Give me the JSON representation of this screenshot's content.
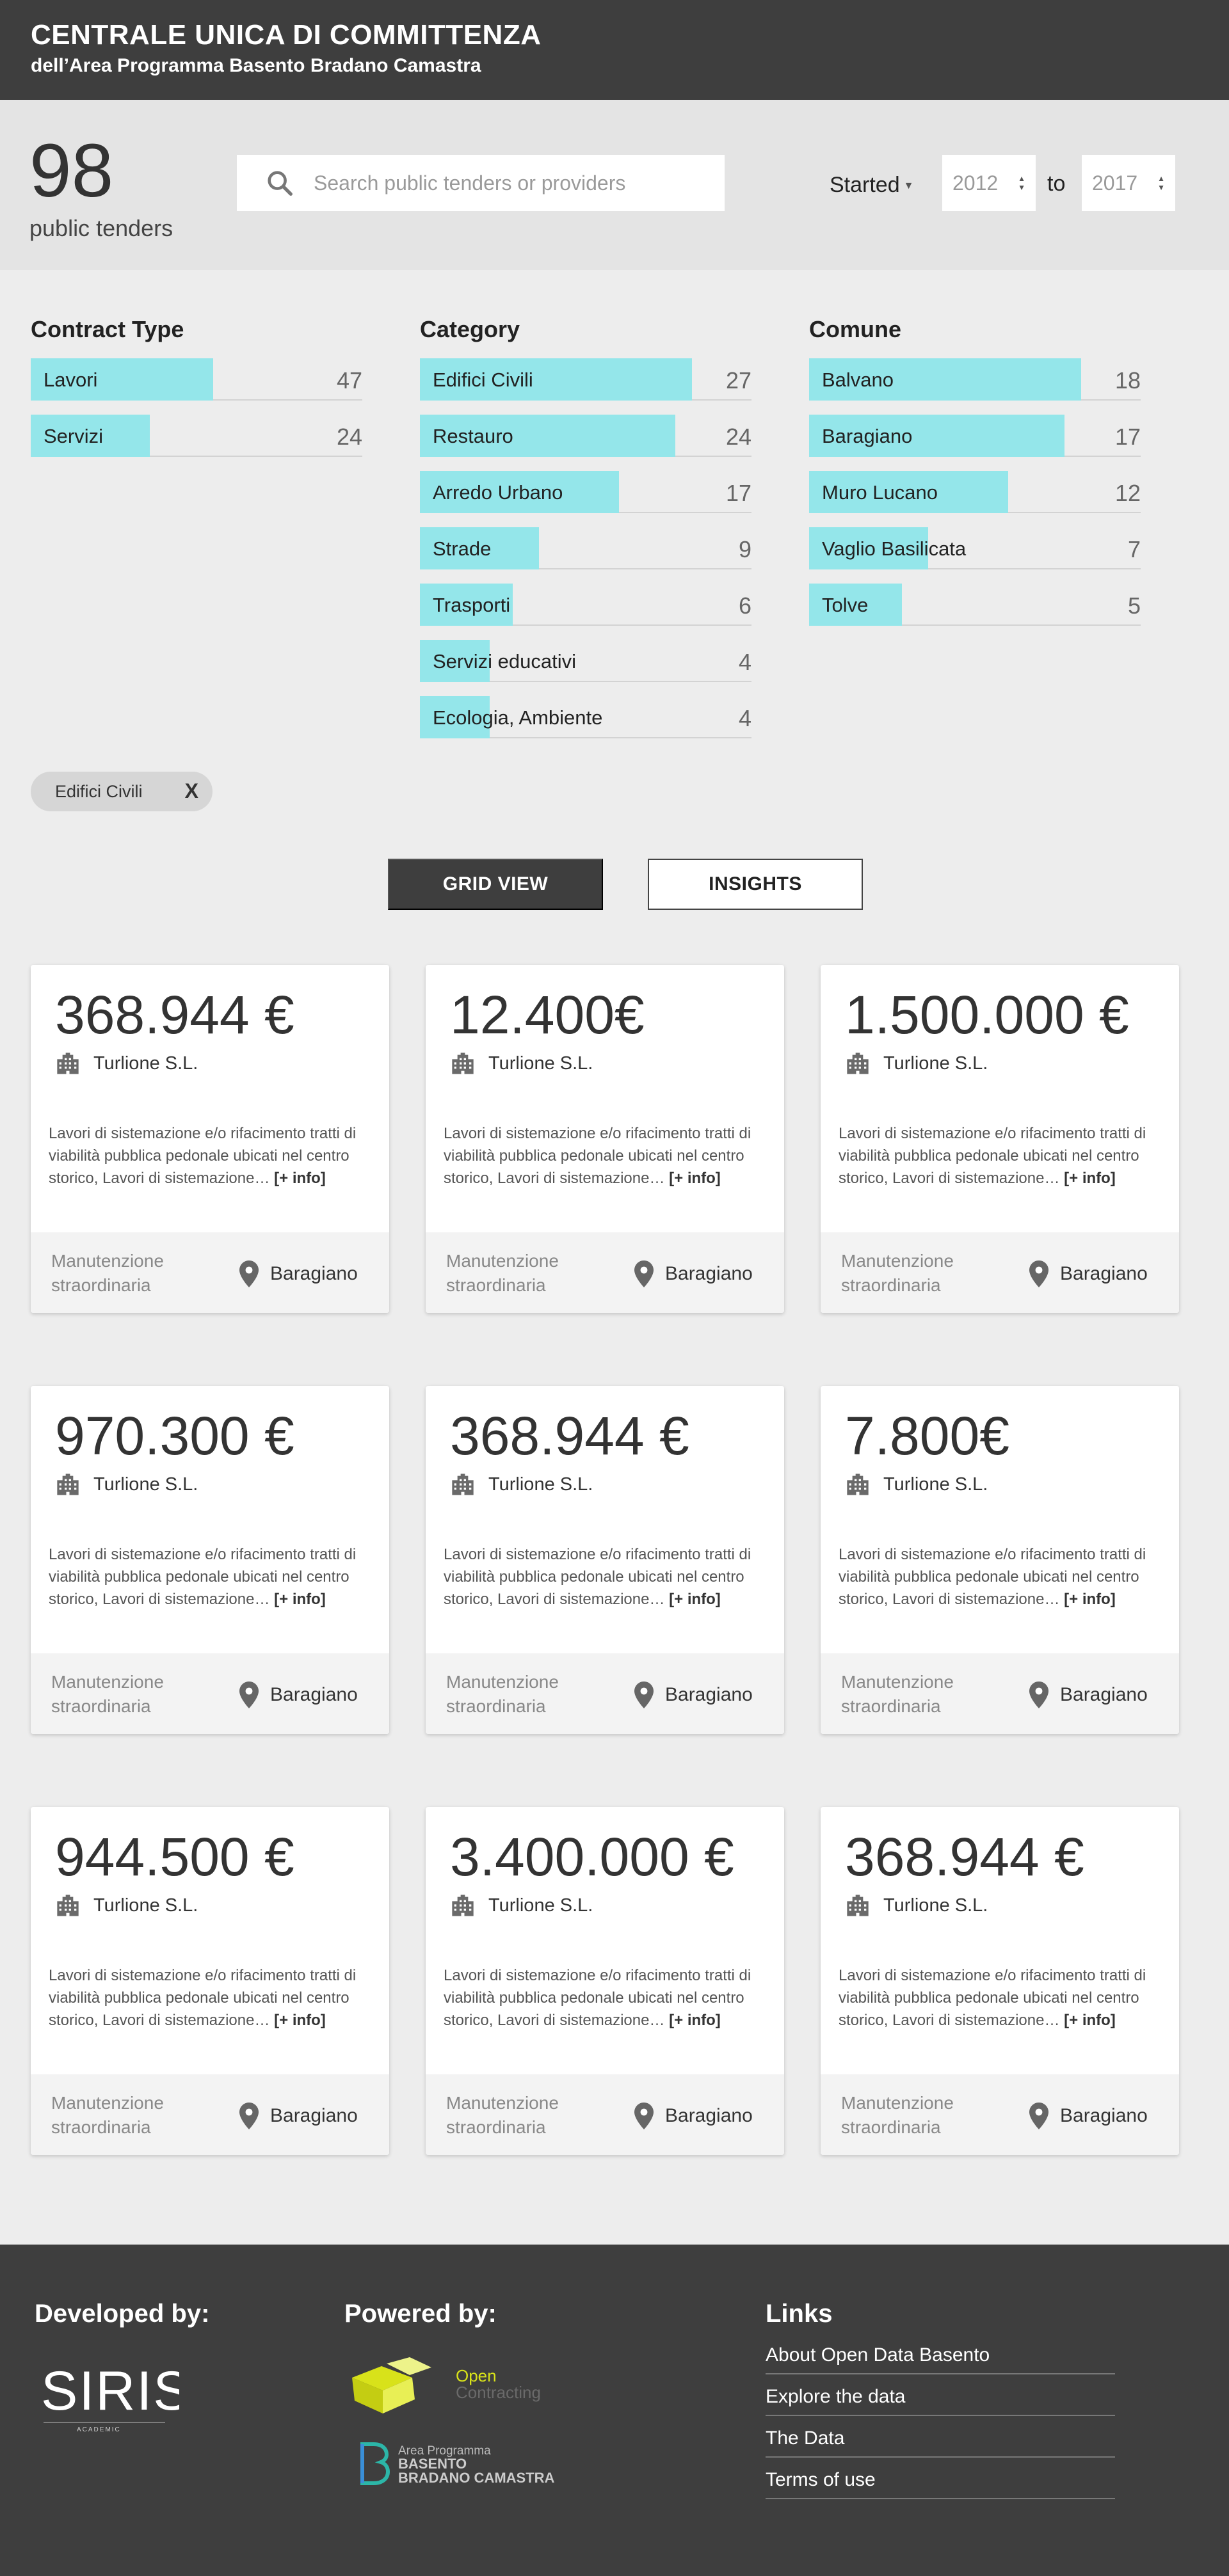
{
  "header": {
    "title": "CENTRALE UNICA DI COMMITTENZA",
    "subtitle": "dell’Area Programma Basento Bradano Camastra"
  },
  "toolbar": {
    "count": "98",
    "count_label": "public tenders",
    "search_placeholder": "Search public tenders or providers",
    "started_label": "Started",
    "from_year": "2012",
    "to_label": "to",
    "to_year": "2017"
  },
  "facets": {
    "contract_type": {
      "title": "Contract Type",
      "items": [
        {
          "label": "Lavori",
          "count": "47",
          "fraction": 0.55
        },
        {
          "label": "Servizi",
          "count": "24",
          "fraction": 0.36
        }
      ]
    },
    "category": {
      "title": "Category",
      "items": [
        {
          "label": "Edifici Civili",
          "count": "27",
          "fraction": 0.82
        },
        {
          "label": "Restauro",
          "count": "24",
          "fraction": 0.77
        },
        {
          "label": "Arredo Urbano",
          "count": "17",
          "fraction": 0.6
        },
        {
          "label": "Strade",
          "count": "9",
          "fraction": 0.36
        },
        {
          "label": "Trasporti",
          "count": "6",
          "fraction": 0.28
        },
        {
          "label": "Servizi educativi",
          "count": "4",
          "fraction": 0.21
        },
        {
          "label": "Ecologia, Ambiente",
          "count": "4",
          "fraction": 0.21
        }
      ]
    },
    "comune": {
      "title": "Comune",
      "items": [
        {
          "label": "Balvano",
          "count": "18",
          "fraction": 0.82
        },
        {
          "label": "Baragiano",
          "count": "17",
          "fraction": 0.77
        },
        {
          "label": "Muro Lucano",
          "count": "12",
          "fraction": 0.6
        },
        {
          "label": "Vaglio Basilicata",
          "count": "7",
          "fraction": 0.36
        },
        {
          "label": "Tolve",
          "count": "5",
          "fraction": 0.28
        }
      ]
    }
  },
  "active_filter": {
    "label": "Edifici Civili",
    "close": "X"
  },
  "views": {
    "grid": "GRID VIEW",
    "insights": "INSIGHTS"
  },
  "cards": [
    {
      "amount": "368.944 €",
      "provider": "Turlione S.L.",
      "description": "Lavori di sistemazione e/o rifacimento tratti di viabilità pubblica pedonale ubicati nel centro storico, Lavori di sistemazione…",
      "more": "[+ info]",
      "type": "Manutenzione straordinaria",
      "location": "Baragiano"
    },
    {
      "amount": "12.400€",
      "provider": "Turlione S.L.",
      "description": "Lavori di sistemazione e/o rifacimento tratti di viabilità pubblica pedonale ubicati nel centro storico, Lavori di sistemazione…",
      "more": "[+ info]",
      "type": "Manutenzione straordinaria",
      "location": "Baragiano"
    },
    {
      "amount": "1.500.000 €",
      "provider": "Turlione S.L.",
      "description": "Lavori di sistemazione e/o rifacimento tratti di viabilità pubblica pedonale ubicati nel centro storico, Lavori di sistemazione…",
      "more": "[+ info]",
      "type": "Manutenzione straordinaria",
      "location": "Baragiano"
    },
    {
      "amount": "970.300 €",
      "provider": "Turlione S.L.",
      "description": "Lavori di sistemazione e/o rifacimento tratti di viabilità pubblica pedonale ubicati nel centro storico, Lavori di sistemazione…",
      "more": "[+ info]",
      "type": "Manutenzione straordinaria",
      "location": "Baragiano"
    },
    {
      "amount": "368.944 €",
      "provider": "Turlione S.L.",
      "description": "Lavori di sistemazione e/o rifacimento tratti di viabilità pubblica pedonale ubicati nel centro storico, Lavori di sistemazione…",
      "more": "[+ info]",
      "type": "Manutenzione straordinaria",
      "location": "Baragiano"
    },
    {
      "amount": "7.800€",
      "provider": "Turlione S.L.",
      "description": "Lavori di sistemazione e/o rifacimento tratti di viabilità pubblica pedonale ubicati nel centro storico, Lavori di sistemazione…",
      "more": "[+ info]",
      "type": "Manutenzione straordinaria",
      "location": "Baragiano"
    },
    {
      "amount": "944.500 €",
      "provider": "Turlione S.L.",
      "description": "Lavori di sistemazione e/o rifacimento tratti di viabilità pubblica pedonale ubicati nel centro storico, Lavori di sistemazione…",
      "more": "[+ info]",
      "type": "Manutenzione straordinaria",
      "location": "Baragiano"
    },
    {
      "amount": "3.400.000 €",
      "provider": "Turlione S.L.",
      "description": "Lavori di sistemazione e/o rifacimento tratti di viabilità pubblica pedonale ubicati nel centro storico, Lavori di sistemazione…",
      "more": "[+ info]",
      "type": "Manutenzione straordinaria",
      "location": "Baragiano"
    },
    {
      "amount": "368.944 €",
      "provider": "Turlione S.L.",
      "description": "Lavori di sistemazione e/o rifacimento tratti di viabilità pubblica pedonale ubicati nel centro storico, Lavori di sistemazione…",
      "more": "[+ info]",
      "type": "Manutenzione straordinaria",
      "location": "Baragiano"
    }
  ],
  "footer": {
    "developed_by": "Developed by:",
    "powered_by": "Powered by:",
    "links_title": "Links",
    "siris_logo_text": "SIRIS",
    "siris_sub": "ACADEMIC",
    "oc_logo_line1": "Open",
    "oc_logo_line2": "Contracting",
    "basento_line1": "Area Programma",
    "basento_line2": "BASENTO",
    "basento_line3": "BRADANO CAMASTRA",
    "links": [
      "About Open Data Basento",
      "Explore the data",
      "The Data",
      "Terms of use"
    ]
  },
  "colors": {
    "header_bg": "#3e3e3e",
    "facet_bar": "#94e6ea",
    "page_bg": "#ededed",
    "oc_yellow": "#d8e21a",
    "basento_teal": "#2cb6a8"
  }
}
